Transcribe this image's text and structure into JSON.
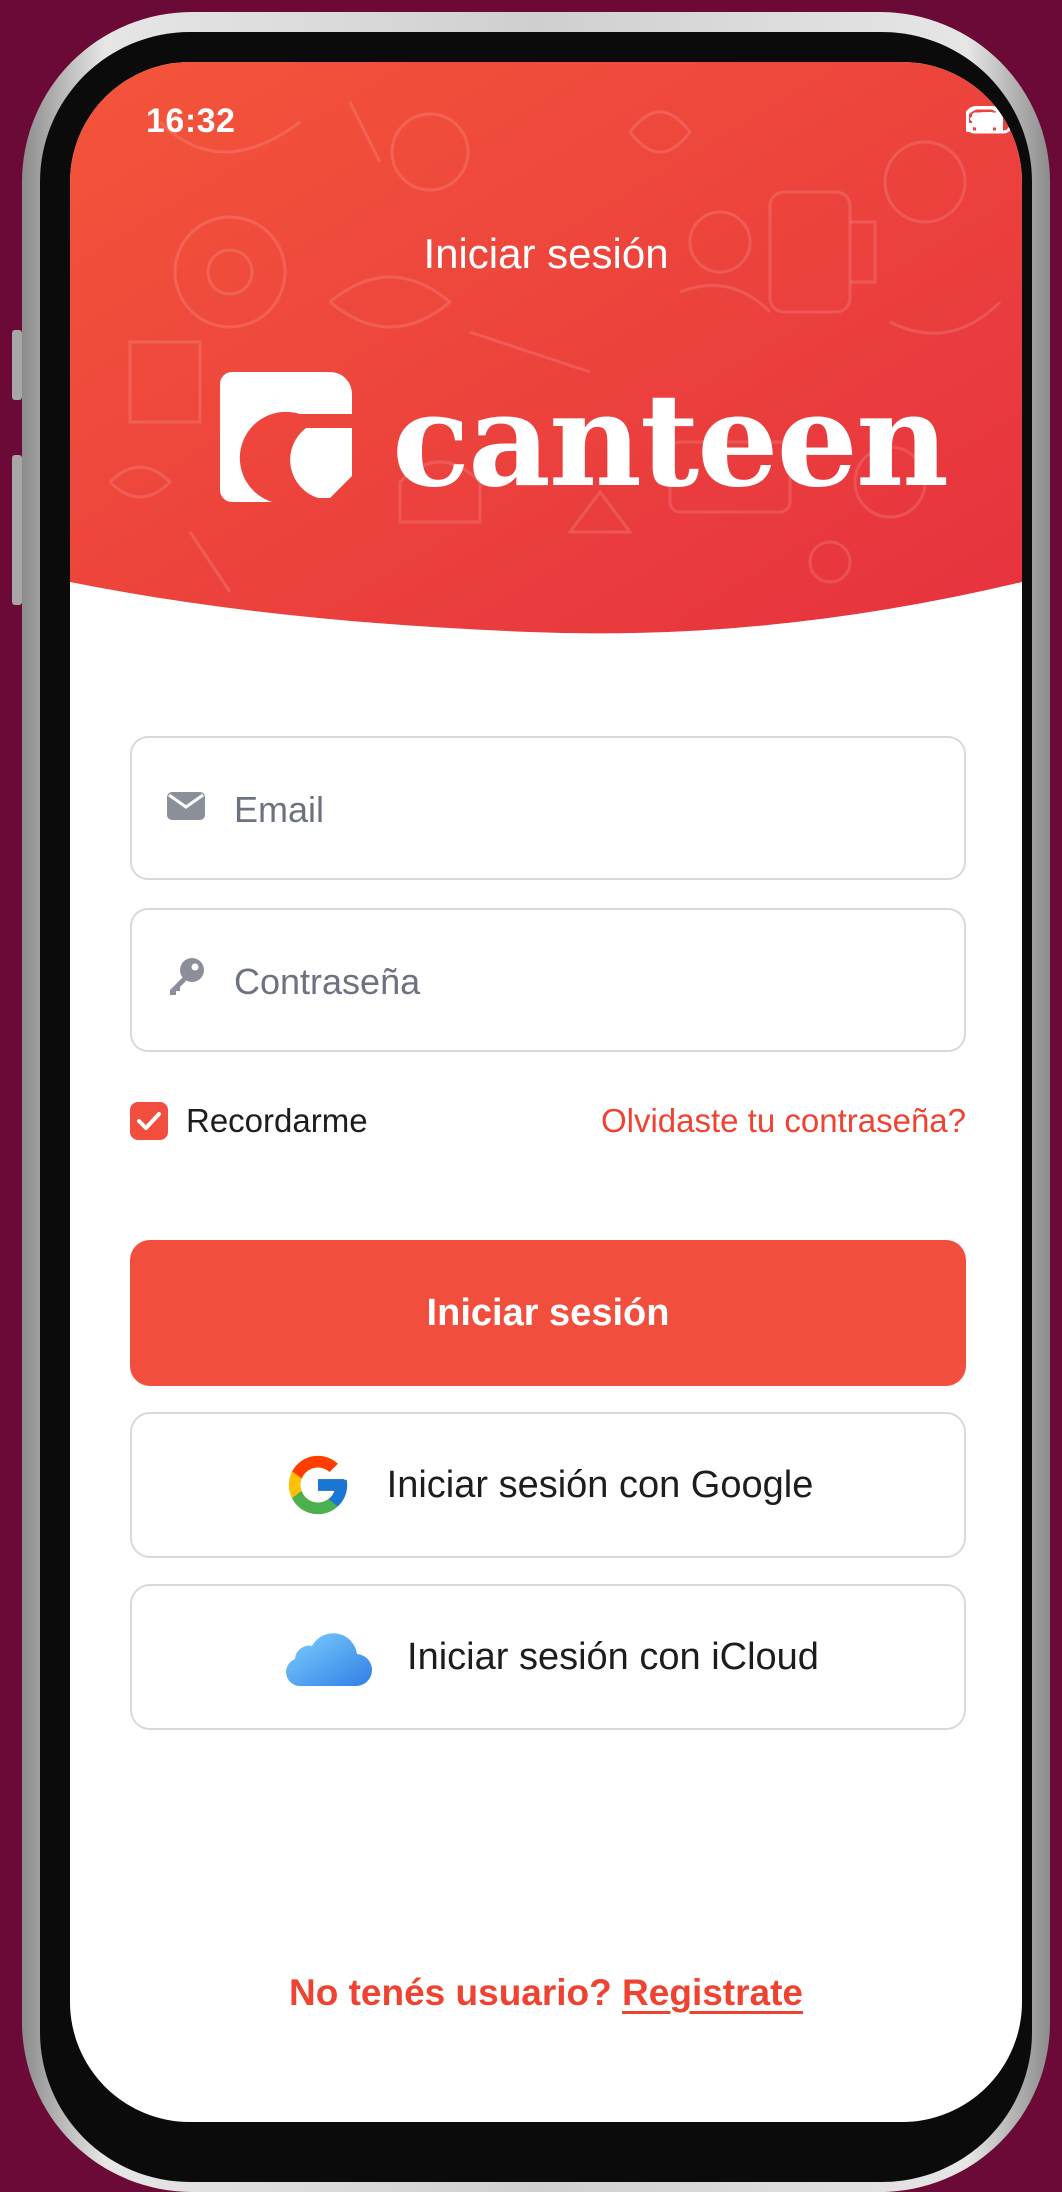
{
  "status_bar": {
    "time": "16:32"
  },
  "header": {
    "title": "Iniciar sesión"
  },
  "brand": {
    "name": "canteen",
    "color": "#f24e3e"
  },
  "form": {
    "email": {
      "placeholder": "Email",
      "value": "",
      "icon": "envelope-icon"
    },
    "password": {
      "placeholder": "Contraseña",
      "value": "",
      "icon": "key-icon"
    },
    "remember": {
      "label": "Recordarme",
      "checked": true
    },
    "forgot_label": "Olvidaste tu contraseña?"
  },
  "actions": {
    "login_label": "Iniciar sesión",
    "google_label": "Iniciar sesión con Google",
    "icloud_label": "Iniciar sesión con iCloud"
  },
  "footer": {
    "question": "No tenés usuario?",
    "register_label": "Registrate"
  },
  "colors": {
    "accent": "#f24e3e",
    "background": "#6b0a36",
    "hero_start": "#f3533b",
    "hero_end": "#e8343f"
  }
}
